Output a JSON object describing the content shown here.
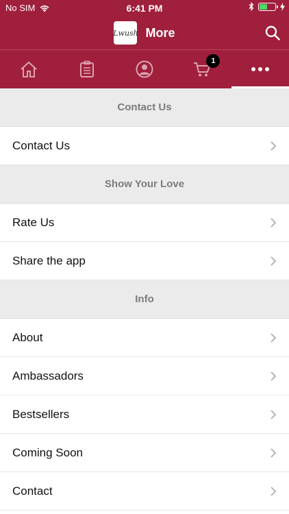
{
  "status_bar": {
    "carrier": "No SIM",
    "time": "6:41 PM"
  },
  "header": {
    "logo_text": "Lwush",
    "title": "More"
  },
  "tabs": [
    {
      "name": "home-icon"
    },
    {
      "name": "orders-icon"
    },
    {
      "name": "profile-icon"
    },
    {
      "name": "cart-icon",
      "badge": "1"
    },
    {
      "name": "more-icon",
      "active": true
    }
  ],
  "sections": [
    {
      "header": "Contact Us",
      "items": [
        "Contact Us"
      ]
    },
    {
      "header": "Show Your Love",
      "items": [
        "Rate Us",
        "Share the app"
      ]
    },
    {
      "header": "Info",
      "items": [
        "About",
        "Ambassadors",
        "Bestsellers",
        "Coming Soon",
        "Contact"
      ]
    }
  ],
  "colors": {
    "brand": "#a01f3c",
    "section_bg": "#ebebeb",
    "battery": "#4cd964"
  },
  "battery_level": 0.45
}
